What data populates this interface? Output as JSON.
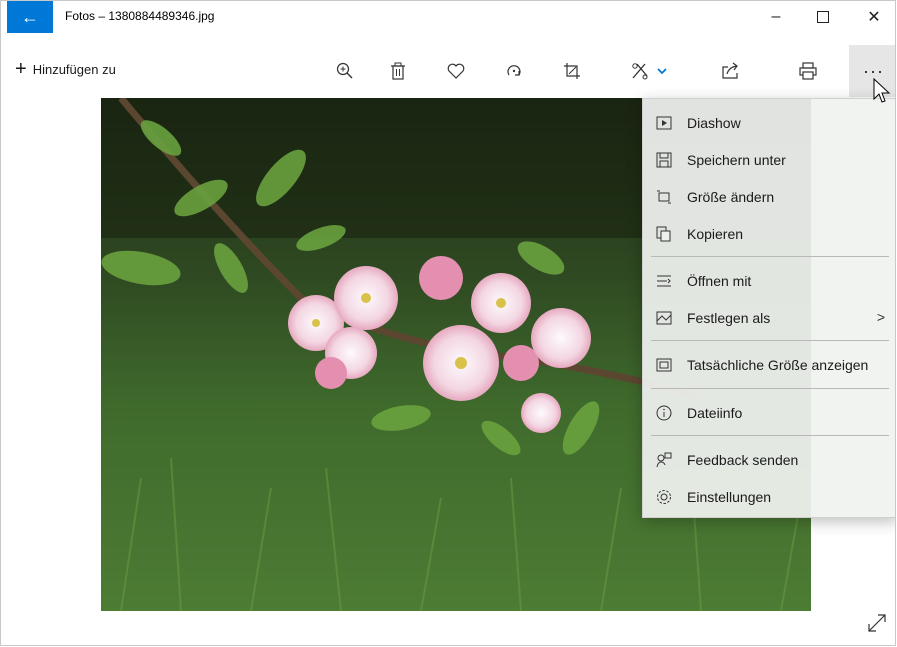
{
  "window": {
    "title": "Fotos – 1380884489346.jpg",
    "back_icon": "arrow-left-icon",
    "minimize_label": "–",
    "maximize_label": "☐",
    "close_label": "✕"
  },
  "toolbar": {
    "add_label": "Hinzufügen zu",
    "more_label": "···",
    "icons": [
      "zoom-in-icon",
      "delete-icon",
      "favorite-icon",
      "rotate-icon",
      "crop-icon",
      "edit-icon",
      "share-icon",
      "print-icon"
    ]
  },
  "menu": {
    "items": [
      {
        "label": "Diashow",
        "icon": "slideshow-icon"
      },
      {
        "label": "Speichern unter",
        "icon": "save-icon"
      },
      {
        "label": "Größe ändern",
        "icon": "resize-icon"
      },
      {
        "label": "Kopieren",
        "icon": "copy-icon"
      },
      {
        "label": "Öffnen mit",
        "icon": "open-with-icon"
      },
      {
        "label": "Festlegen als",
        "icon": "set-as-icon",
        "arrow": ">"
      },
      {
        "label": "Tatsächliche Größe anzeigen",
        "icon": "actual-size-icon"
      },
      {
        "label": "Dateiinfo",
        "icon": "info-icon"
      },
      {
        "label": "Feedback senden",
        "icon": "feedback-icon"
      },
      {
        "label": "Einstellungen",
        "icon": "settings-icon"
      }
    ]
  },
  "colors": {
    "accent": "#0078d7"
  }
}
